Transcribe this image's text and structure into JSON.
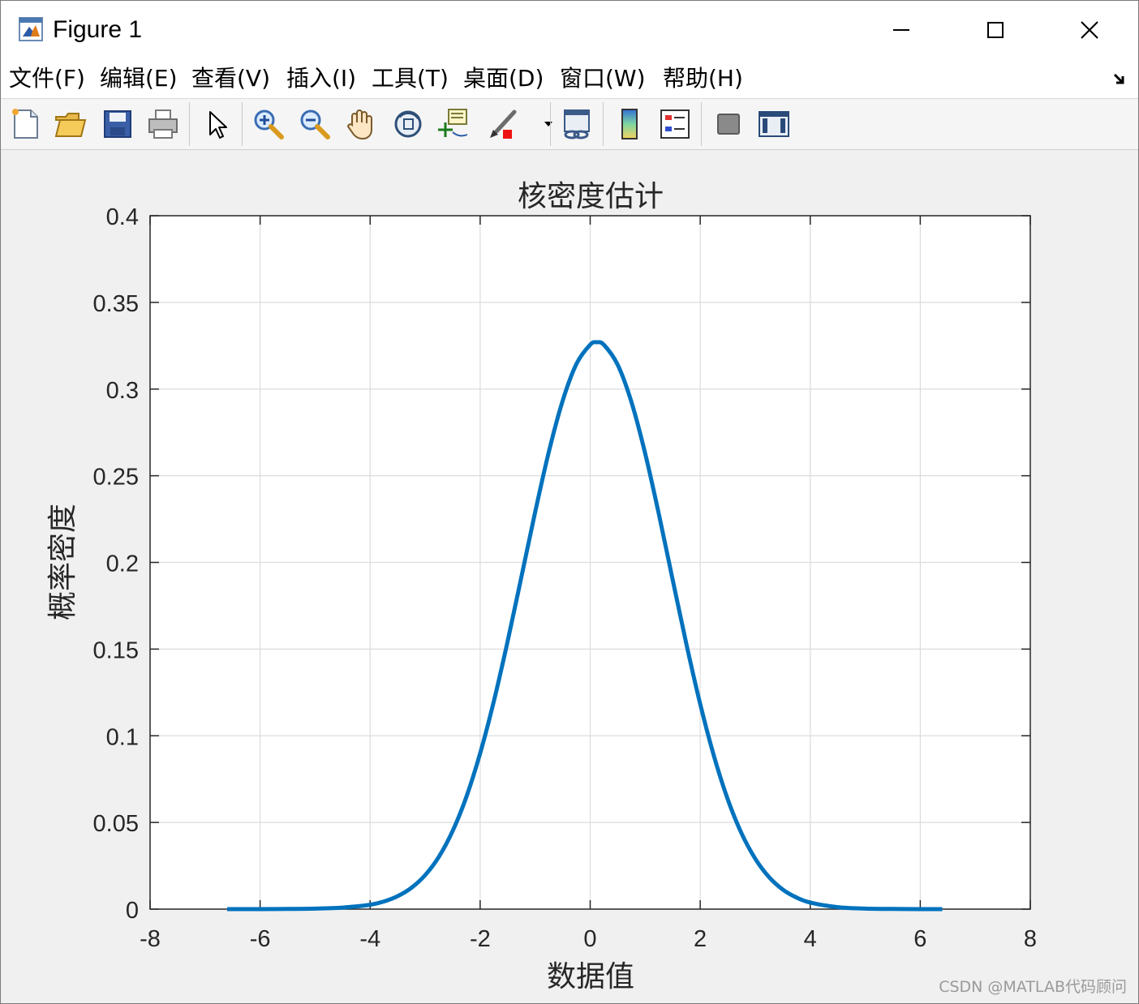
{
  "window": {
    "title": "Figure 1"
  },
  "menu": [
    {
      "label": "文件(F)"
    },
    {
      "label": "编辑(E)"
    },
    {
      "label": "查看(V)"
    },
    {
      "label": "插入(I)"
    },
    {
      "label": "工具(T)"
    },
    {
      "label": "桌面(D)"
    },
    {
      "label": "窗口(W)"
    },
    {
      "label": "帮助(H)"
    }
  ],
  "toolbar": {
    "icons": [
      "new-figure-icon",
      "open-file-icon",
      "save-icon",
      "print-icon",
      "edit-plot-arrow-icon",
      "zoom-in-icon",
      "zoom-out-icon",
      "pan-hand-icon",
      "rotate-3d-icon",
      "data-cursor-icon",
      "brush-icon",
      "link-plot-icon",
      "insert-colorbar-icon",
      "insert-legend-icon",
      "hide-plot-tools-icon",
      "show-plot-tools-icon"
    ]
  },
  "watermark": "CSDN @MATLAB代码顾问",
  "colors": {
    "line": "#0072bd",
    "grid": "#dcdcdc",
    "axes": "#262626"
  },
  "chart_data": {
    "type": "line",
    "title": "核密度估计",
    "xlabel": "数据值",
    "ylabel": "概率密度",
    "xlim": [
      -8,
      8
    ],
    "ylim": [
      0,
      0.4
    ],
    "xticks": [
      "-8",
      "-6",
      "-4",
      "-2",
      "0",
      "2",
      "4",
      "6",
      "8"
    ],
    "yticks": [
      "0",
      "0.05",
      "0.1",
      "0.15",
      "0.2",
      "0.25",
      "0.3",
      "0.35",
      "0.4"
    ],
    "grid": true,
    "series": [
      {
        "x": [
          -6.6,
          -6.0,
          -5.5,
          -5.0,
          -4.5,
          -4.0,
          -3.75,
          -3.5,
          -3.25,
          -3.0,
          -2.75,
          -2.5,
          -2.25,
          -2.0,
          -1.75,
          -1.5,
          -1.25,
          -1.0,
          -0.75,
          -0.5,
          -0.25,
          0.0,
          0.12,
          0.25,
          0.5,
          0.75,
          1.0,
          1.25,
          1.5,
          1.75,
          2.0,
          2.25,
          2.5,
          2.75,
          3.0,
          3.25,
          3.5,
          3.75,
          4.0,
          4.5,
          5.0,
          5.5,
          6.0,
          6.4
        ],
        "y": [
          0.0,
          0.0,
          0.0001,
          0.0003,
          0.0009,
          0.0025,
          0.0044,
          0.0075,
          0.0123,
          0.0196,
          0.0302,
          0.0451,
          0.0648,
          0.0899,
          0.1201,
          0.1546,
          0.1917,
          0.2291,
          0.264,
          0.2933,
          0.3145,
          0.3256,
          0.327,
          0.3255,
          0.314,
          0.2925,
          0.2628,
          0.2276,
          0.1899,
          0.1527,
          0.1183,
          0.0883,
          0.0634,
          0.0438,
          0.0291,
          0.0185,
          0.0113,
          0.0067,
          0.0038,
          0.0011,
          0.0003,
          0.0001,
          0.0,
          0.0
        ]
      }
    ]
  }
}
